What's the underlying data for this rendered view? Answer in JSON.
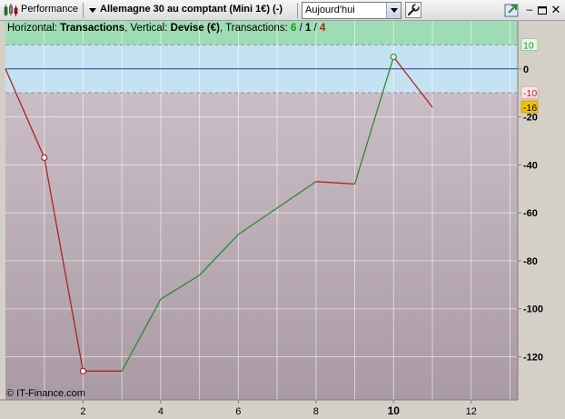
{
  "toolbar": {
    "performance_label": "Performance",
    "instrument_label": "Allemagne 30 au comptant (Mini 1€) (-)",
    "period_value": "Aujourd'hui",
    "min_glyph": "–",
    "close_glyph": "✕"
  },
  "info": {
    "horizontal_label": "Horizontal:",
    "horizontal_value": "Transactions",
    "vertical_label": ", Vertical:",
    "vertical_value": "Devise (€)",
    "transactions_label": ", Transactions:",
    "wins": "6",
    "sep1": " / ",
    "flat": "1",
    "sep2": " / ",
    "losses": "4"
  },
  "copyright": "© IT-Finance.com",
  "colors": {
    "win_line": "#2e8b2e",
    "loss_line": "#b22222",
    "profit_zone": "#9edcb5",
    "neutral_zone": "#c5e2f2",
    "loss_zone_top": "#cbbdc6",
    "loss_zone_bottom": "#a99aa3",
    "zero_line": "#2a3b9e",
    "gain_badge": "#7fd07f",
    "loss_badge": "#f2c200"
  },
  "chart_data": {
    "type": "line",
    "xlabel": "",
    "ylabel": "",
    "xlim": [
      0,
      13.2
    ],
    "ylim": [
      -138,
      20
    ],
    "x_ticks": [
      "2",
      "4",
      "6",
      "8",
      "10",
      "12"
    ],
    "x_tick_values": [
      2,
      4,
      6,
      8,
      10,
      12
    ],
    "y_ticks": [
      "0",
      "-20",
      "-40",
      "-60",
      "-80",
      "-100",
      "-120"
    ],
    "y_tick_values": [
      0,
      -20,
      -40,
      -60,
      -80,
      -100,
      -120
    ],
    "take_profit": 10,
    "stop_loss": -10,
    "take_profit_label": "10",
    "stop_loss_label": "-10",
    "current_value_label": "-16",
    "current_value": -16,
    "highlight_x": "10",
    "x": [
      0,
      1,
      2,
      3,
      4,
      5,
      6,
      7,
      8,
      9,
      10,
      11
    ],
    "y": [
      0,
      -37,
      -126,
      -126,
      -96,
      -86,
      -69,
      -58,
      -47,
      -48,
      5,
      -16
    ],
    "markers": [
      {
        "x": 1,
        "y": -37,
        "color": "#b22222"
      },
      {
        "x": 2,
        "y": -126,
        "color": "#b22222"
      },
      {
        "x": 10,
        "y": 5,
        "color": "#2e8b2e"
      }
    ]
  }
}
